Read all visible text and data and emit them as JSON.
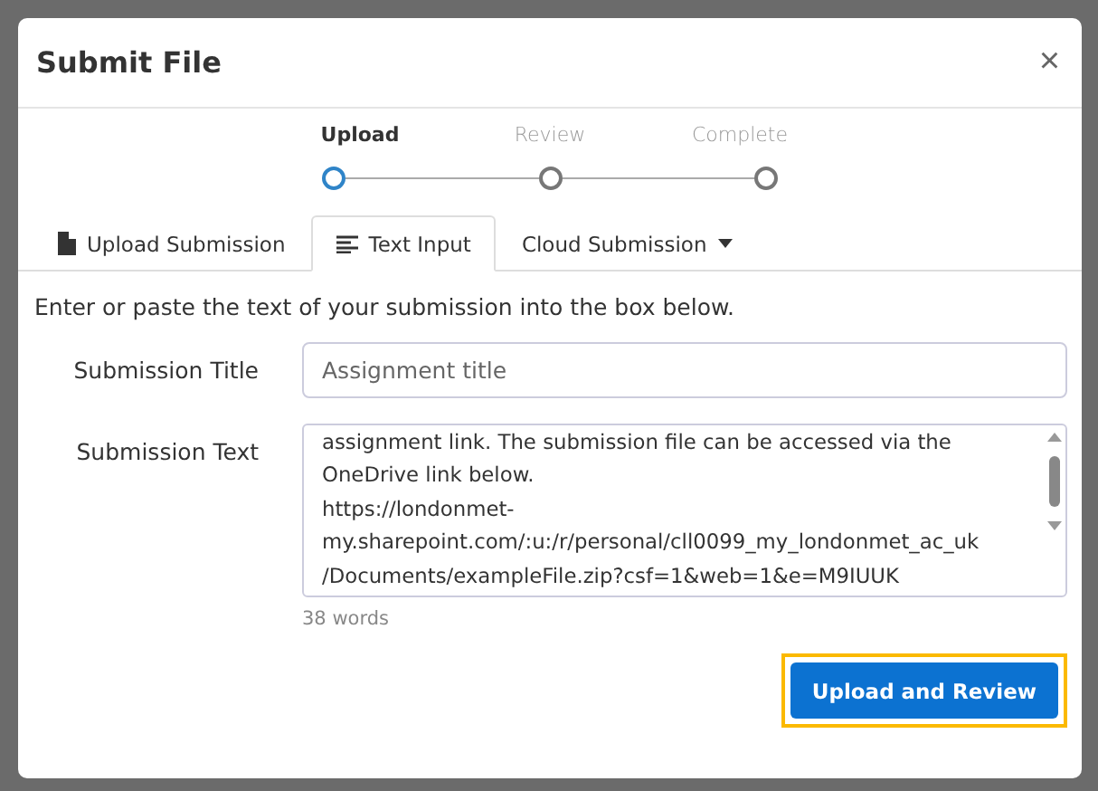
{
  "dialog": {
    "title": "Submit File",
    "close": "×"
  },
  "steps": [
    {
      "label": "Upload",
      "selected": true
    },
    {
      "label": "Review",
      "selected": false
    },
    {
      "label": "Complete",
      "selected": false
    }
  ],
  "tabs": [
    {
      "label": "Upload Submission",
      "kind": "file",
      "selected": false,
      "dropdown": false
    },
    {
      "label": "Text Input",
      "kind": "text",
      "selected": true,
      "dropdown": false
    },
    {
      "label": "Cloud Submission",
      "kind": "none",
      "selected": false,
      "dropdown": true
    }
  ],
  "intro": "Enter or paste the text of your submission into the box below.",
  "form": {
    "title_label": "Submission Title",
    "title_placeholder": "Assignment title",
    "text_label": "Submission Text",
    "text_value": "assignment link. The submission file can be accessed via the\nOneDrive link below.\nhttps://londonmet-\nmy.sharepoint.com/:u:/r/personal/cll0099_my_londonmet_ac_uk\n/Documents/exampleFile.zip?csf=1&web=1&e=M9IUUK",
    "word_count": "38 words"
  },
  "button": {
    "label": "Upload and Review",
    "highlighted": true
  }
}
